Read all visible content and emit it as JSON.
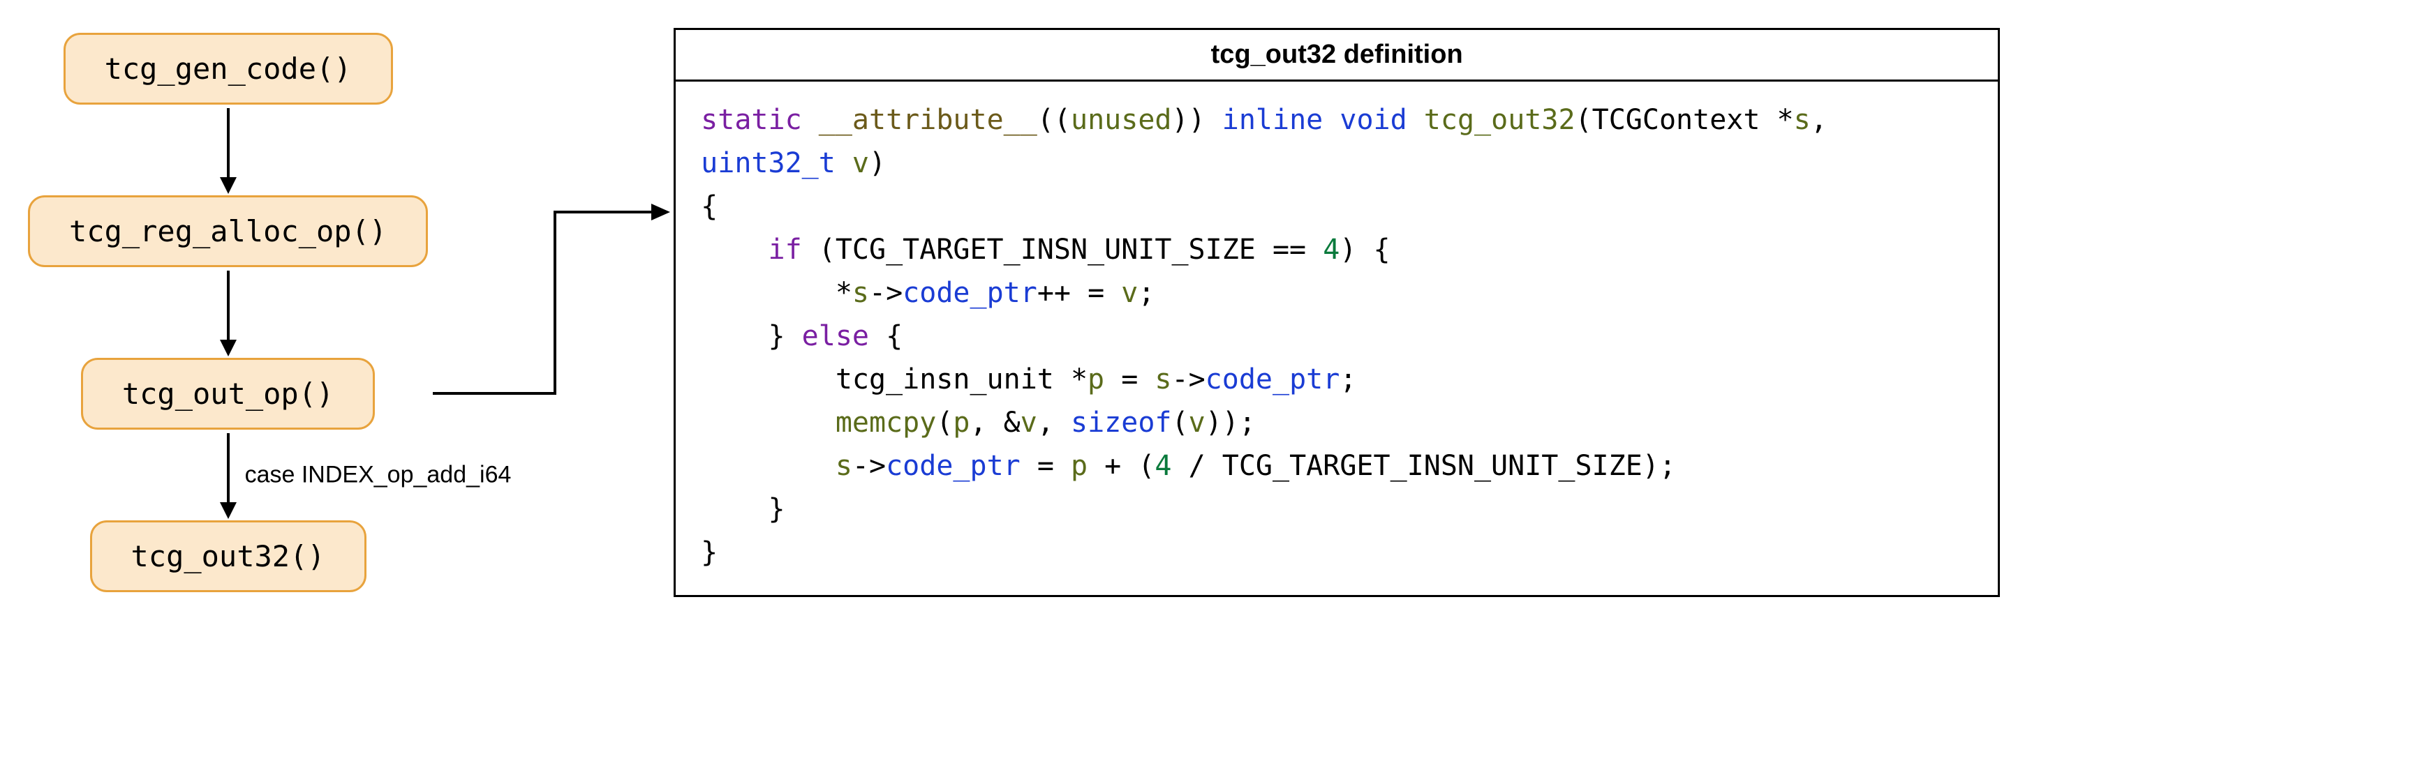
{
  "flow": {
    "nodes": [
      {
        "label": "tcg_gen_code()"
      },
      {
        "label": "tcg_reg_alloc_op()"
      },
      {
        "label": "tcg_out_op()"
      },
      {
        "label": "tcg_out32()"
      }
    ],
    "edge_labels": [
      "",
      "",
      "case INDEX_op_add_i64"
    ]
  },
  "code_panel": {
    "title": "tcg_out32 definition",
    "tokens": {
      "static": "static",
      "attribute": "__attribute__",
      "unused_open": "((",
      "unused": "unused",
      "unused_close": "))",
      "inline": "inline",
      "void": "void",
      "funcname": "tcg_out32",
      "params_open": "(TCGContext *",
      "param_s": "s",
      "params_mid": ",",
      "uint32": "uint32_t",
      "param_v": "v",
      "params_close": ")",
      "brace_open": "{",
      "if": "if",
      "cond_open": " (TCG_TARGET_INSN_UNIT_SIZE == ",
      "four_a": "4",
      "cond_close": ") {",
      "deref": "*",
      "s_ident": "s",
      "arrow1": "->",
      "code_ptr1": "code_ptr",
      "inc_assign": "++ = ",
      "v1": "v",
      "semi1": ";",
      "else_close": "} ",
      "else": "else",
      "else_open": " {",
      "insn_unit": "tcg_insn_unit *",
      "p_ident": "p",
      "eq1": " = ",
      "s2": "s",
      "arrow2": "->",
      "code_ptr2": "code_ptr",
      "semi2": ";",
      "memcpy": "memcpy",
      "memcpy_args_open": "(",
      "p_arg": "p",
      "comma1": ", &",
      "v_arg": "v",
      "comma2": ", ",
      "sizeof": "sizeof",
      "sizeof_open": "(",
      "v_sz": "v",
      "sizeof_close": "));",
      "s3": "s",
      "arrow3": "->",
      "code_ptr3": "code_ptr",
      "eq2": " = ",
      "p2": "p",
      "plus": " + (",
      "four_b": "4",
      "div": " / TCG_TARGET_INSN_UNIT_SIZE);",
      "inner_close": "}",
      "brace_close": "}"
    }
  }
}
